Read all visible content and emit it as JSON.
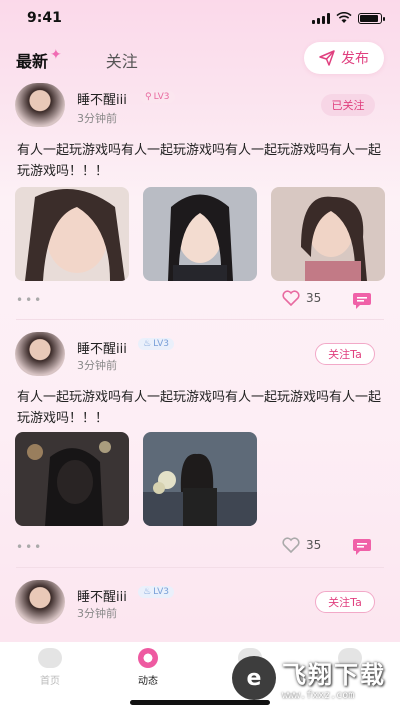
{
  "status": {
    "time": "9:41"
  },
  "header": {
    "tabs": [
      {
        "label": "最新",
        "active": true
      },
      {
        "label": "关注",
        "active": false
      }
    ],
    "publish_label": "发布"
  },
  "posts": [
    {
      "username": "睡不醒iii",
      "level": "LV3",
      "time_ago": "3分钟前",
      "follow_label": "已关注",
      "text": "有人一起玩游戏吗有人一起玩游戏吗有人一起玩游戏吗有人一起玩游戏吗！！！",
      "likes": "35",
      "liked": true
    },
    {
      "username": "睡不醒iii",
      "level": "LV3",
      "time_ago": "3分钟前",
      "follow_label": "关注Ta",
      "text": "有人一起玩游戏吗有人一起玩游戏吗有人一起玩游戏吗有人一起玩游戏吗！！！",
      "likes": "35",
      "liked": false
    },
    {
      "username": "睡不醒iii",
      "level": "LV3",
      "time_ago": "3分钟前",
      "follow_label": "关注Ta"
    }
  ],
  "tabbar": {
    "items": [
      {
        "label": "首页",
        "icon": "home-icon"
      },
      {
        "label": "动态",
        "icon": "moments-icon",
        "active": true
      },
      {
        "label": "",
        "icon": "message-icon"
      },
      {
        "label": "",
        "icon": "profile-icon"
      }
    ]
  },
  "watermark": {
    "title": "飞翔下载",
    "url": "www.fxxz.com"
  },
  "colors": {
    "accent": "#e0407f",
    "pink_light": "#f7d6e6"
  }
}
